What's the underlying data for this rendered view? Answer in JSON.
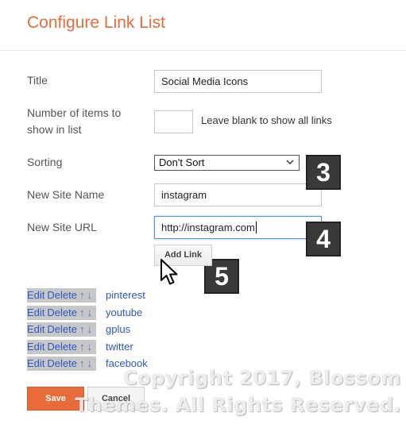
{
  "dialog": {
    "title": "Configure Link List"
  },
  "form": {
    "title_label": "Title",
    "title_value": "Social Media Icons",
    "items_label_line1": "Number of items to",
    "items_label_line2": "show in list",
    "items_value": "",
    "items_hint": "Leave blank to show all links",
    "sorting_label": "Sorting",
    "sorting_value": "Don't Sort",
    "new_site_name_label": "New Site Name",
    "new_site_name_value": "instagram",
    "new_site_url_label": "New Site URL",
    "new_site_url_value": "http://instagram.com",
    "add_link_label": "Add Link"
  },
  "steps": [
    "3",
    "4",
    "5"
  ],
  "link_controls": {
    "edit": "Edit",
    "delete": "Delete",
    "up": "↑",
    "down": "↓"
  },
  "links": [
    {
      "name": "pinterest"
    },
    {
      "name": "youtube"
    },
    {
      "name": "gplus"
    },
    {
      "name": "twitter"
    },
    {
      "name": "facebook"
    }
  ],
  "footer": {
    "save_label": "Save",
    "cancel_label": "Cancel"
  },
  "watermark": {
    "line1": "Copyright 2017, Blossom",
    "line2": "Themes. All Rights Reserved."
  },
  "colors": {
    "accent": "#e96b3a",
    "link": "#2b57c7",
    "focus": "#4d90fe"
  },
  "icons": {
    "cursor": "mouse-pointer-icon",
    "dropdown": "chevron-down-icon"
  }
}
